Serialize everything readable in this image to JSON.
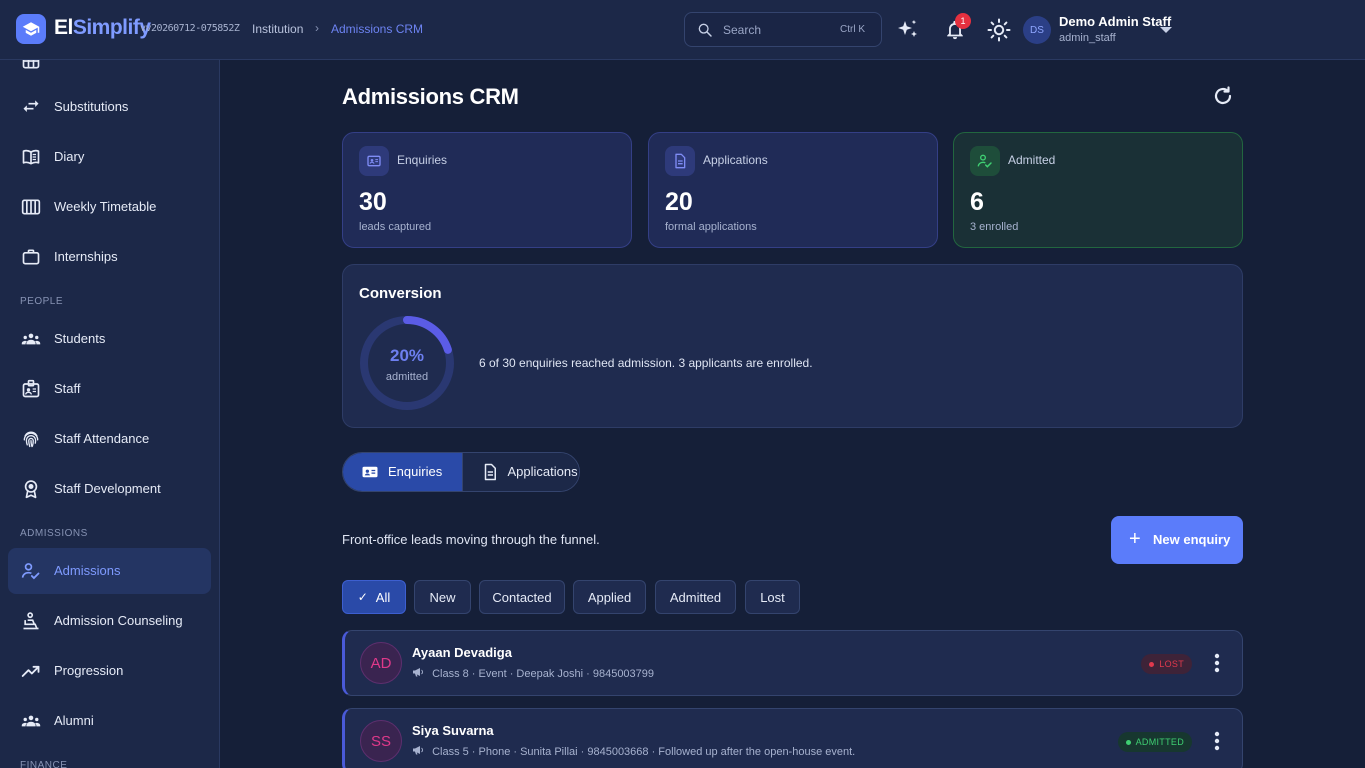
{
  "topbar": {
    "brand_part1": "El",
    "brand_part2": "Simplify",
    "version": "vv20260712-075852Z",
    "breadcrumb": [
      "Institution",
      "Admissions CRM"
    ],
    "search_placeholder": "Search",
    "search_shortcut": "Ctrl K",
    "notification_count": "1",
    "user_initials": "DS",
    "user_name": "Demo Admin Staff",
    "user_role": "admin_staff"
  },
  "sidebar": {
    "items_top": [
      {
        "label": "Substitutions",
        "icon": "swap-icon"
      },
      {
        "label": "Diary",
        "icon": "book-icon"
      },
      {
        "label": "Weekly Timetable",
        "icon": "timetable-icon"
      },
      {
        "label": "Internships",
        "icon": "briefcase-icon"
      }
    ],
    "section_people": "PEOPLE",
    "items_people": [
      {
        "label": "Students",
        "icon": "groups-icon"
      },
      {
        "label": "Staff",
        "icon": "badge-icon"
      },
      {
        "label": "Staff Attendance",
        "icon": "fingerprint-icon"
      },
      {
        "label": "Staff Development",
        "icon": "award-icon"
      }
    ],
    "section_admissions": "ADMISSIONS",
    "items_admissions": [
      {
        "label": "Admissions",
        "icon": "how-to-reg-icon",
        "active": true
      },
      {
        "label": "Admission Counseling",
        "icon": "chair-icon"
      },
      {
        "label": "Progression",
        "icon": "trending-up-icon"
      },
      {
        "label": "Alumni",
        "icon": "groups-icon"
      }
    ],
    "section_finance": "FINANCE"
  },
  "main": {
    "title": "Admissions CRM",
    "stats": [
      {
        "label": "Enquiries",
        "value": "30",
        "sub": "leads captured",
        "icon": "contact-card-icon"
      },
      {
        "label": "Applications",
        "value": "20",
        "sub": "formal applications",
        "icon": "document-icon"
      },
      {
        "label": "Admitted",
        "value": "6",
        "sub": "3 enrolled",
        "icon": "how-to-reg-icon"
      }
    ],
    "conversion": {
      "title": "Conversion",
      "percent_label": "20%",
      "percent_value": 0.2,
      "percent_sub": "admitted",
      "summary": "6 of 30 enquiries reached admission. 3 applicants are enrolled."
    },
    "tabs": [
      {
        "label": "Enquiries",
        "active": true
      },
      {
        "label": "Applications",
        "active": false
      }
    ],
    "funnel_text": "Front-office leads moving through the funnel.",
    "new_button": "New enquiry",
    "filters": [
      {
        "label": "All",
        "active": true
      },
      {
        "label": "New",
        "active": false
      },
      {
        "label": "Contacted",
        "active": false
      },
      {
        "label": "Applied",
        "active": false
      },
      {
        "label": "Admitted",
        "active": false
      },
      {
        "label": "Lost",
        "active": false
      }
    ],
    "rows": [
      {
        "initials": "AD",
        "name": "Ayaan Devadiga",
        "meta": "Class 8 · Event · Deepak Joshi · 9845003799",
        "status": "LOST"
      },
      {
        "initials": "SS",
        "name": "Siya Suvarna",
        "meta": "Class 5 · Phone · Sunita Pillai · 9845003668 · Followed up after the open-house event.",
        "status": "ADMITTED"
      }
    ]
  },
  "colors": {
    "accent": "#5b7cfa",
    "background": "#151f38",
    "panel": "#1c2848",
    "lost": "#e0394d",
    "admitted": "#3fcf72"
  }
}
